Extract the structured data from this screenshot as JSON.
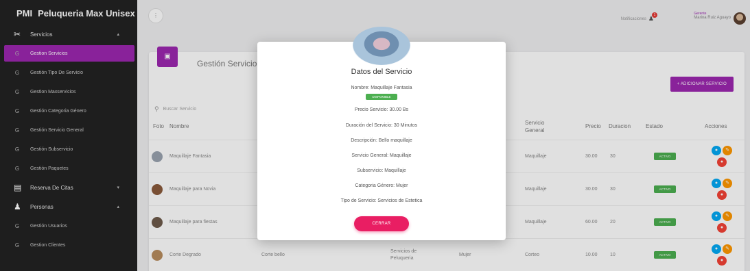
{
  "brand": {
    "mini": "PMI",
    "name": "Peluqueria Max Unisex"
  },
  "sidebar": {
    "items": [
      {
        "icon": "✂",
        "label": "Servicios",
        "kind": "big",
        "caret": "▴"
      },
      {
        "icon": "G",
        "label": "Gestion Servicios",
        "kind": "active"
      },
      {
        "icon": "G",
        "label": "Gestión Tipo De Servicio"
      },
      {
        "icon": "G",
        "label": "Gestion Maxservicios"
      },
      {
        "icon": "G",
        "label": "Gestión Categoria Género"
      },
      {
        "icon": "G",
        "label": "Gestión Servicio General"
      },
      {
        "icon": "G",
        "label": "Gestión Subservicio"
      },
      {
        "icon": "G",
        "label": "Gestión Paquetes"
      },
      {
        "icon": "▤",
        "label": "Reserva De Citas",
        "kind": "big",
        "caret": "▾"
      },
      {
        "icon": "♟",
        "label": "Personas",
        "kind": "big",
        "caret": "▴"
      },
      {
        "icon": "G",
        "label": "Gestión Usuarios"
      },
      {
        "icon": "G",
        "label": "Gestion Clientes"
      }
    ]
  },
  "topbar": {
    "menu_icon": "⋮",
    "notifications_label": "Notificaciones",
    "notifications_count": "1",
    "user_role": "Gerente",
    "user_name": "Marina Ruiz Aguayo"
  },
  "card": {
    "icon": "▣",
    "title": "Gestión Servicio",
    "add_button": "+ ADICIONAR SERVICIO",
    "search_placeholder": "Buscar Servicio",
    "columns": {
      "foto": "Foto",
      "nombre": "Nombre",
      "servicio_general": "Servicio General",
      "precio": "Precio",
      "duracion": "Duracion",
      "estado": "Estado",
      "acciones": "Acciones"
    },
    "rows": [
      {
        "nombre": "Maquillaje Fantasia",
        "servicio_general": "Maquillaje",
        "precio": "30.00",
        "duracion": "30",
        "estado": "ACTIVO"
      },
      {
        "nombre": "Maquillaje para Novia",
        "servicio_general": "Maquillaje",
        "precio": "30.00",
        "duracion": "30",
        "estado": "ACTIVO"
      },
      {
        "nombre": "Maquillaje para fiestas",
        "servicio_general": "Maquillaje",
        "precio": "60.00",
        "duracion": "20",
        "estado": "ACTIVO"
      },
      {
        "nombre": "Corte Degrado",
        "subservicio": "Corte bello",
        "tipo": "Servicios de Peluqueria",
        "genero": "Mujer",
        "servicio_general": "Corteo",
        "precio": "10.00",
        "duracion": "10",
        "estado": "ACTIVO"
      }
    ]
  },
  "modal": {
    "title": "Datos del Servicio",
    "nombre": "Nombre: Maquillaje Fantasia",
    "badge": "DISPONIBLE",
    "precio": "Precio Servicio: 30.00 Bs",
    "duracion": "Duración del Servicio: 30 Minutos",
    "descripcion": "Descripción: Bello maquillaje",
    "servicio_general": "Servicio General: Maquillaje",
    "subservicio": "Subservicio: Maquillaje",
    "categoria": "Categoria Género: Mujer",
    "tipo": "Tipo de Servicio: Servicios de Estetica",
    "close_button": "CERRAR"
  },
  "colors": {
    "accent": "#9c27b0",
    "close": "#e91e63",
    "active": "#4caf50"
  }
}
